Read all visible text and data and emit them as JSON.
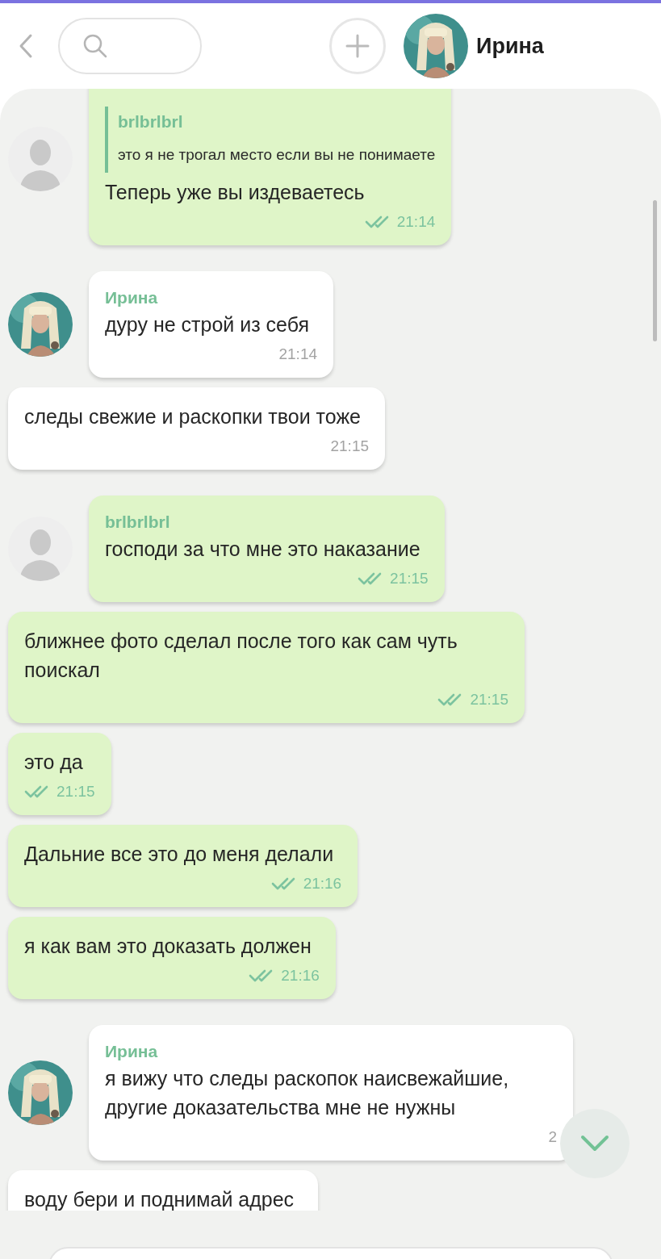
{
  "header": {
    "contact_name": "Ирина"
  },
  "messages": [
    {
      "kind": "outgoing",
      "avatar": {
        "kind": "placeholder"
      },
      "quote": {
        "sender": "brlbrlbrl",
        "text": "это я не трогал место если вы не понимаете"
      },
      "text": "Теперь уже вы издеваетесь",
      "time": "21:14",
      "read": true
    },
    {
      "kind": "incoming",
      "avatar": {
        "kind": "person"
      },
      "sender": "Ирина",
      "text": "дуру не строй из себя",
      "time": "21:14"
    },
    {
      "kind": "incoming",
      "text": "следы свежие и раскопки твои тоже",
      "time": "21:15"
    },
    {
      "kind": "outgoing",
      "avatar": {
        "kind": "placeholder"
      },
      "sender": "brlbrlbrl",
      "text": "господи за что мне это наказание",
      "time": "21:15",
      "read": true
    },
    {
      "kind": "outgoing",
      "text": "ближнее фото сделал после того как сам чуть поискал",
      "time": "21:15",
      "read": true
    },
    {
      "kind": "outgoing",
      "text": "это да",
      "time": "21:15",
      "read": true
    },
    {
      "kind": "outgoing",
      "text": "Дальние все это до меня делали",
      "time": "21:16",
      "read": true
    },
    {
      "kind": "outgoing",
      "text": "я как вам это доказать должен",
      "time": "21:16",
      "read": true
    },
    {
      "kind": "incoming",
      "avatar": {
        "kind": "person"
      },
      "sender": "Ирина",
      "text": "я вижу что следы раскопок наисвежайшие, другие доказательства мне не нужны",
      "time": "2"
    },
    {
      "kind": "incoming",
      "text": "воду бери и поднимай адрес"
    }
  ]
}
